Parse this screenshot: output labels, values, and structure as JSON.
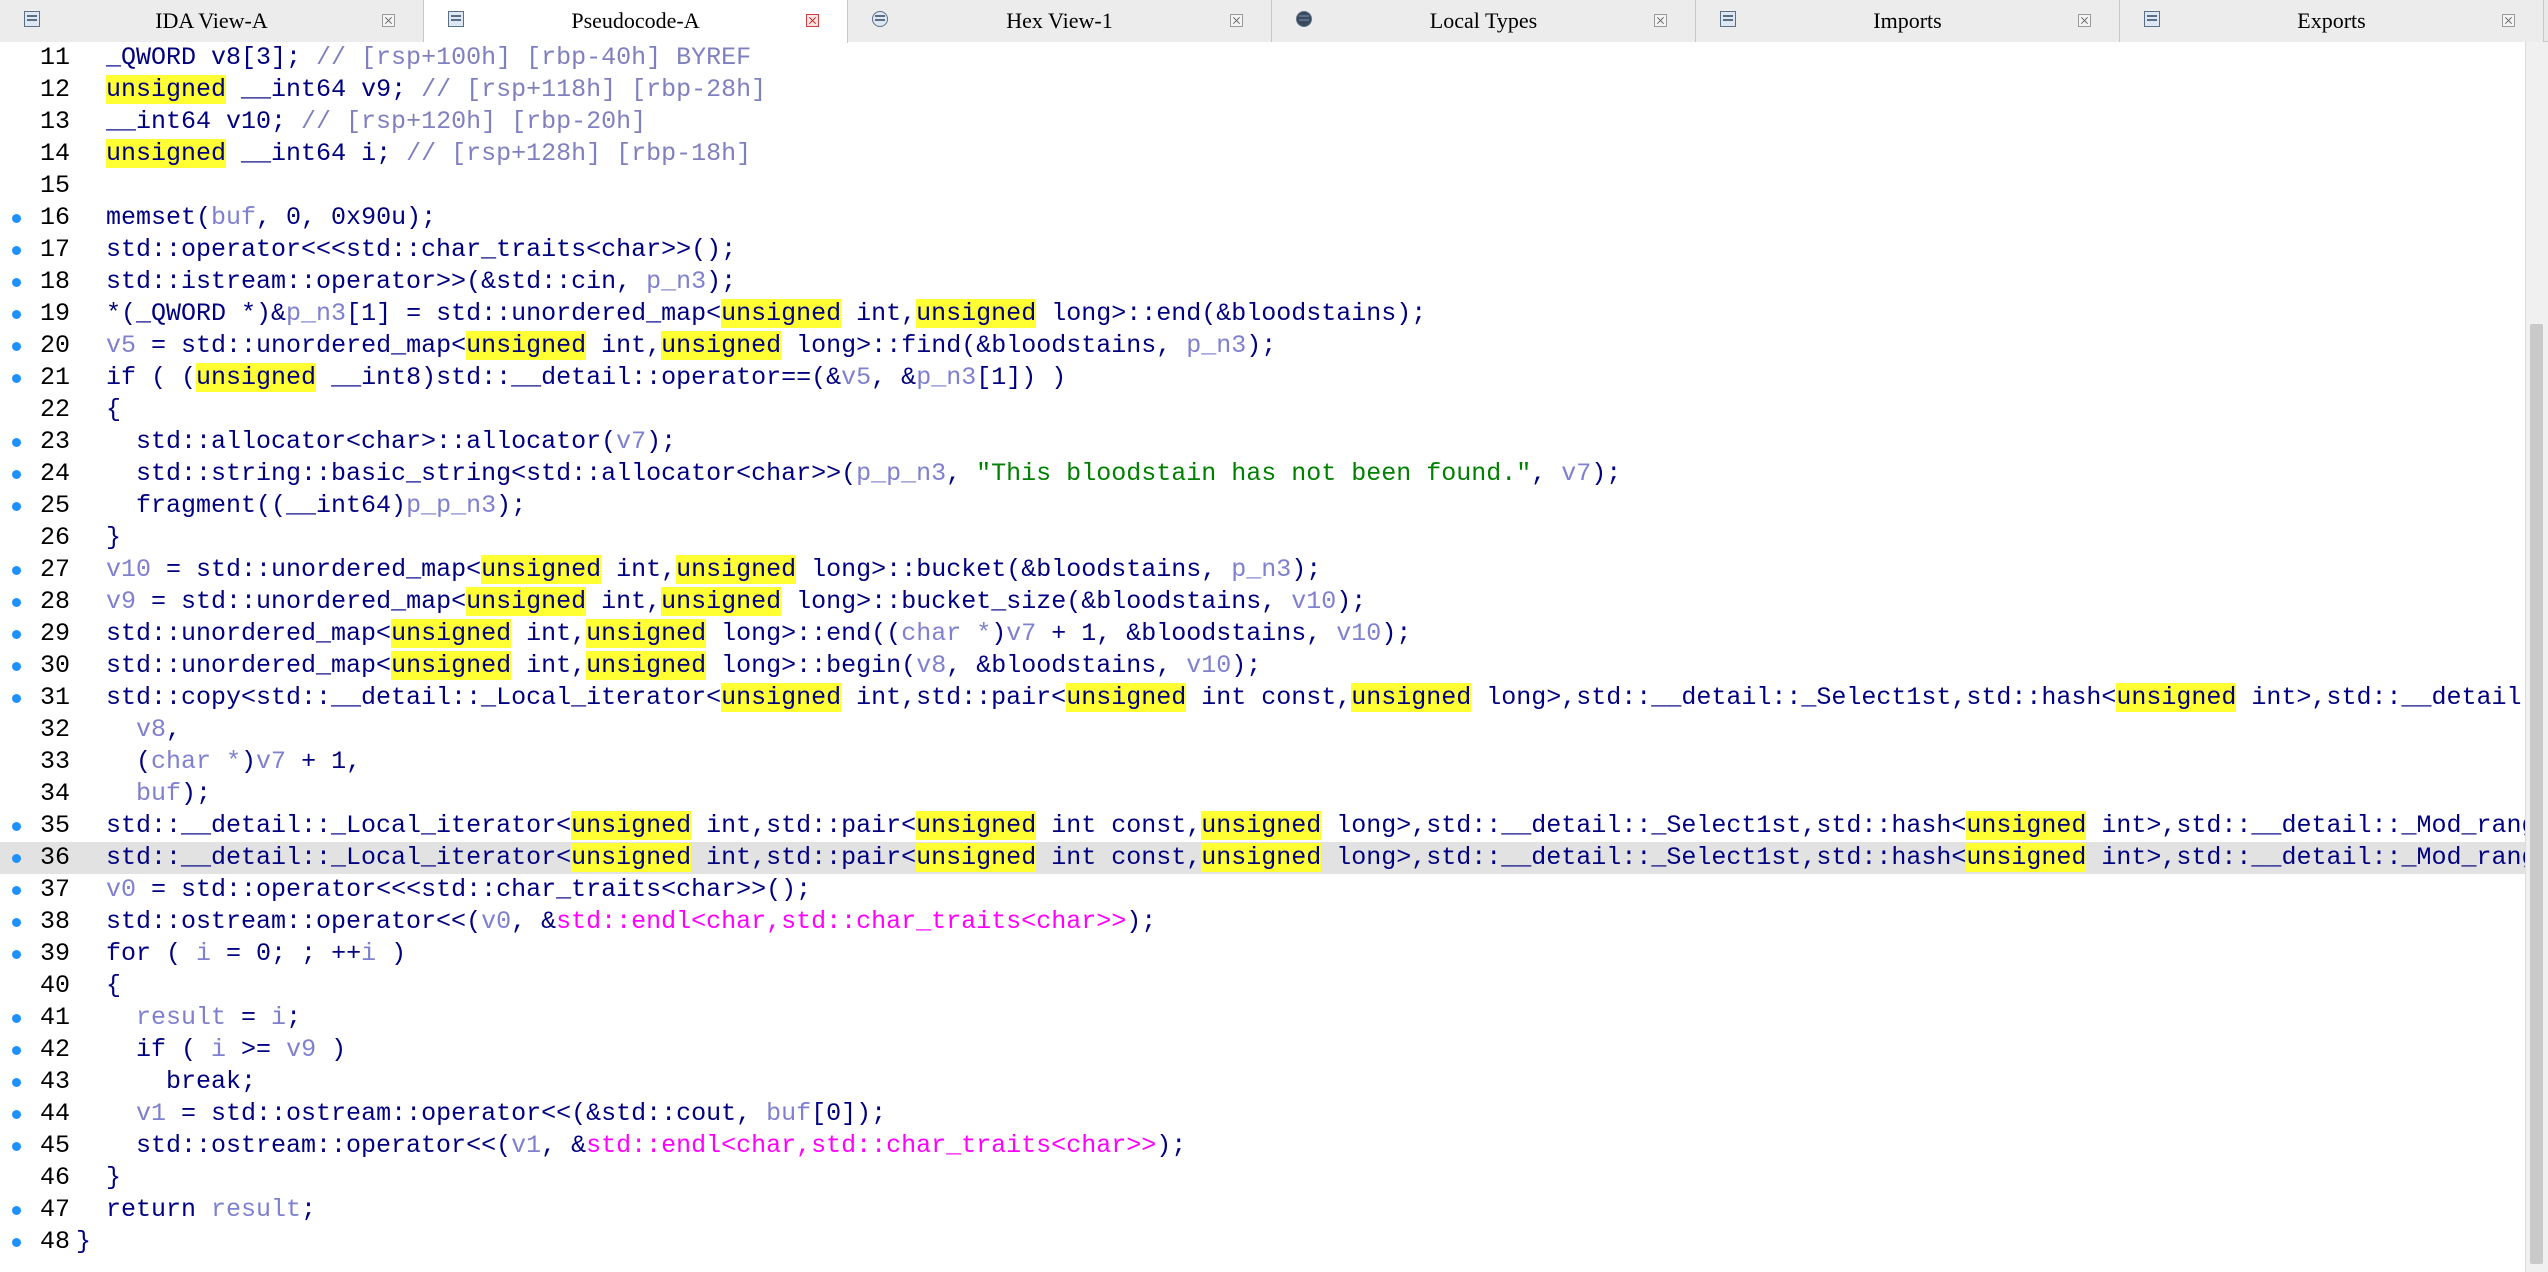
{
  "tabs": [
    {
      "label": "IDA View-A",
      "icon": "ida-view-icon",
      "active": false
    },
    {
      "label": "Pseudocode-A",
      "icon": "pseudocode-icon",
      "active": true
    },
    {
      "label": "Hex View-1",
      "icon": "hex-view-icon",
      "active": false
    },
    {
      "label": "Local Types",
      "icon": "local-types-icon",
      "active": false
    },
    {
      "label": "Imports",
      "icon": "imports-icon",
      "active": false
    },
    {
      "label": "Exports",
      "icon": "exports-icon",
      "active": false
    }
  ],
  "colors": {
    "keyword": "#000080",
    "variable": "#8080d0",
    "comment": "#8080c0",
    "string": "#008000",
    "macro": "#ff00ff",
    "highlight": "#ffff33",
    "breakpoint_dot": "#1e90ff"
  },
  "current_line": "36",
  "lines": [
    {
      "no": "11",
      "dot": false,
      "tokens": [
        [
          "p",
          "  _QWORD v8[3]; "
        ],
        [
          "c",
          "// [rsp+100h] [rbp-40h] BYREF"
        ]
      ]
    },
    {
      "no": "12",
      "dot": false,
      "tokens": [
        [
          "p",
          "  "
        ],
        [
          "h",
          "unsigned"
        ],
        [
          "p",
          " __int64 v9; "
        ],
        [
          "c",
          "// [rsp+118h] [rbp-28h]"
        ]
      ]
    },
    {
      "no": "13",
      "dot": false,
      "tokens": [
        [
          "p",
          "  __int64 v10; "
        ],
        [
          "c",
          "// [rsp+120h] [rbp-20h]"
        ]
      ]
    },
    {
      "no": "14",
      "dot": false,
      "tokens": [
        [
          "p",
          "  "
        ],
        [
          "h",
          "unsigned"
        ],
        [
          "p",
          " __int64 i; "
        ],
        [
          "c",
          "// [rsp+128h] [rbp-18h]"
        ]
      ]
    },
    {
      "no": "15",
      "dot": false,
      "tokens": [
        [
          "p",
          ""
        ]
      ]
    },
    {
      "no": "16",
      "dot": true,
      "tokens": [
        [
          "p",
          "  memset("
        ],
        [
          "v",
          "buf"
        ],
        [
          "p",
          ", 0, 0x90u);"
        ]
      ]
    },
    {
      "no": "17",
      "dot": true,
      "tokens": [
        [
          "p",
          "  std::operator<<<std::char_traits<char>>();"
        ]
      ]
    },
    {
      "no": "18",
      "dot": true,
      "tokens": [
        [
          "p",
          "  std::istream::operator>>(&std::cin, "
        ],
        [
          "v",
          "p_n3"
        ],
        [
          "p",
          ");"
        ]
      ]
    },
    {
      "no": "19",
      "dot": true,
      "tokens": [
        [
          "p",
          "  *(_QWORD *)&"
        ],
        [
          "v",
          "p_n3"
        ],
        [
          "p",
          "[1] = std::unordered_map<"
        ],
        [
          "h",
          "unsigned"
        ],
        [
          "p",
          " int,"
        ],
        [
          "h",
          "unsigned"
        ],
        [
          "p",
          " long>::end(&bloodstains);"
        ]
      ]
    },
    {
      "no": "20",
      "dot": true,
      "tokens": [
        [
          "p",
          "  "
        ],
        [
          "v",
          "v5"
        ],
        [
          "p",
          " = std::unordered_map<"
        ],
        [
          "h",
          "unsigned"
        ],
        [
          "p",
          " int,"
        ],
        [
          "h",
          "unsigned"
        ],
        [
          "p",
          " long>::find(&bloodstains, "
        ],
        [
          "v",
          "p_n3"
        ],
        [
          "p",
          ");"
        ]
      ]
    },
    {
      "no": "21",
      "dot": true,
      "tokens": [
        [
          "p",
          "  if ( ("
        ],
        [
          "h",
          "unsigned"
        ],
        [
          "p",
          " __int8)std::__detail::operator==(&"
        ],
        [
          "v",
          "v5"
        ],
        [
          "p",
          ", &"
        ],
        [
          "v",
          "p_n3"
        ],
        [
          "p",
          "[1]) )"
        ]
      ]
    },
    {
      "no": "22",
      "dot": false,
      "tokens": [
        [
          "p",
          "  {"
        ]
      ]
    },
    {
      "no": "23",
      "dot": true,
      "tokens": [
        [
          "p",
          "    std::allocator<char>::allocator("
        ],
        [
          "v",
          "v7"
        ],
        [
          "p",
          ");"
        ]
      ]
    },
    {
      "no": "24",
      "dot": true,
      "tokens": [
        [
          "p",
          "    std::string::basic_string<std::allocator<char>>("
        ],
        [
          "v",
          "p_p_n3"
        ],
        [
          "p",
          ", "
        ],
        [
          "s",
          "\"This bloodstain has not been found.\""
        ],
        [
          "p",
          ", "
        ],
        [
          "v",
          "v7"
        ],
        [
          "p",
          ");"
        ]
      ]
    },
    {
      "no": "25",
      "dot": true,
      "tokens": [
        [
          "p",
          "    fragment((__int64)"
        ],
        [
          "v",
          "p_p_n3"
        ],
        [
          "p",
          ");"
        ]
      ]
    },
    {
      "no": "26",
      "dot": false,
      "tokens": [
        [
          "p",
          "  }"
        ]
      ]
    },
    {
      "no": "27",
      "dot": true,
      "tokens": [
        [
          "p",
          "  "
        ],
        [
          "v",
          "v10"
        ],
        [
          "p",
          " = std::unordered_map<"
        ],
        [
          "h",
          "unsigned"
        ],
        [
          "p",
          " int,"
        ],
        [
          "h",
          "unsigned"
        ],
        [
          "p",
          " long>::bucket(&bloodstains, "
        ],
        [
          "v",
          "p_n3"
        ],
        [
          "p",
          ");"
        ]
      ]
    },
    {
      "no": "28",
      "dot": true,
      "tokens": [
        [
          "p",
          "  "
        ],
        [
          "v",
          "v9"
        ],
        [
          "p",
          " = std::unordered_map<"
        ],
        [
          "h",
          "unsigned"
        ],
        [
          "p",
          " int,"
        ],
        [
          "h",
          "unsigned"
        ],
        [
          "p",
          " long>::bucket_size(&bloodstains, "
        ],
        [
          "v",
          "v10"
        ],
        [
          "p",
          ");"
        ]
      ]
    },
    {
      "no": "29",
      "dot": true,
      "tokens": [
        [
          "p",
          "  std::unordered_map<"
        ],
        [
          "h",
          "unsigned"
        ],
        [
          "p",
          " int,"
        ],
        [
          "h",
          "unsigned"
        ],
        [
          "p",
          " long>::end(("
        ],
        [
          "v",
          "char *"
        ],
        [
          "p",
          ")"
        ],
        [
          "v",
          "v7"
        ],
        [
          "p",
          " + 1, &bloodstains, "
        ],
        [
          "v",
          "v10"
        ],
        [
          "p",
          ");"
        ]
      ]
    },
    {
      "no": "30",
      "dot": true,
      "tokens": [
        [
          "p",
          "  std::unordered_map<"
        ],
        [
          "h",
          "unsigned"
        ],
        [
          "p",
          " int,"
        ],
        [
          "h",
          "unsigned"
        ],
        [
          "p",
          " long>::begin("
        ],
        [
          "v",
          "v8"
        ],
        [
          "p",
          ", &bloodstains, "
        ],
        [
          "v",
          "v10"
        ],
        [
          "p",
          ");"
        ]
      ]
    },
    {
      "no": "31",
      "dot": true,
      "tokens": [
        [
          "p",
          "  std::copy<std::__detail::_Local_iterator<"
        ],
        [
          "h",
          "unsigned"
        ],
        [
          "p",
          " int,std::pair<"
        ],
        [
          "h",
          "unsigned"
        ],
        [
          "p",
          " int const,"
        ],
        [
          "h",
          "unsigned"
        ],
        [
          "p",
          " long>,std::__detail::_Select1st,std::hash<"
        ],
        [
          "h",
          "unsigned"
        ],
        [
          "p",
          " int>,std::__detail"
        ]
      ]
    },
    {
      "no": "32",
      "dot": false,
      "tokens": [
        [
          "p",
          "    "
        ],
        [
          "v",
          "v8"
        ],
        [
          "p",
          ","
        ]
      ]
    },
    {
      "no": "33",
      "dot": false,
      "tokens": [
        [
          "p",
          "    ("
        ],
        [
          "v",
          "char *"
        ],
        [
          "p",
          ")"
        ],
        [
          "v",
          "v7"
        ],
        [
          "p",
          " + 1,"
        ]
      ]
    },
    {
      "no": "34",
      "dot": false,
      "tokens": [
        [
          "p",
          "    "
        ],
        [
          "v",
          "buf"
        ],
        [
          "p",
          ");"
        ]
      ]
    },
    {
      "no": "35",
      "dot": true,
      "tokens": [
        [
          "p",
          "  std::__detail::_Local_iterator<"
        ],
        [
          "h",
          "unsigned"
        ],
        [
          "p",
          " int,std::pair<"
        ],
        [
          "h",
          "unsigned"
        ],
        [
          "p",
          " int const,"
        ],
        [
          "h",
          "unsigned"
        ],
        [
          "p",
          " long>,std::__detail::_Select1st,std::hash<"
        ],
        [
          "h",
          "unsigned"
        ],
        [
          "p",
          " int>,std::__detail::_Mod_rang"
        ]
      ]
    },
    {
      "no": "36",
      "dot": true,
      "tokens": [
        [
          "p",
          "  std::__detail::_Local_iterator<"
        ],
        [
          "h",
          "unsigned"
        ],
        [
          "p",
          " int,std::pair<"
        ],
        [
          "h",
          "unsigned"
        ],
        [
          "p",
          " int const,"
        ],
        [
          "h",
          "unsigned"
        ],
        [
          "p",
          " long>,std::__detail::_Select1st,std::hash<"
        ],
        [
          "h",
          "unsigned"
        ],
        [
          "p",
          " int>,std::__detail::_Mod_rang"
        ]
      ]
    },
    {
      "no": "37",
      "dot": true,
      "tokens": [
        [
          "p",
          "  "
        ],
        [
          "v",
          "v0"
        ],
        [
          "p",
          " = std::operator<<<std::char_traits<char>>();"
        ]
      ]
    },
    {
      "no": "38",
      "dot": true,
      "tokens": [
        [
          "p",
          "  std::ostream::operator<<("
        ],
        [
          "v",
          "v0"
        ],
        [
          "p",
          ", &"
        ],
        [
          "m",
          "std::endl<char,std::char_traits<char>>"
        ],
        [
          "p",
          ");"
        ]
      ]
    },
    {
      "no": "39",
      "dot": true,
      "tokens": [
        [
          "p",
          "  for ( "
        ],
        [
          "v",
          "i"
        ],
        [
          "p",
          " = 0; ; ++"
        ],
        [
          "v",
          "i"
        ],
        [
          "p",
          " )"
        ]
      ]
    },
    {
      "no": "40",
      "dot": false,
      "tokens": [
        [
          "p",
          "  {"
        ]
      ]
    },
    {
      "no": "41",
      "dot": true,
      "tokens": [
        [
          "p",
          "    "
        ],
        [
          "v",
          "result"
        ],
        [
          "p",
          " = "
        ],
        [
          "v",
          "i"
        ],
        [
          "p",
          ";"
        ]
      ]
    },
    {
      "no": "42",
      "dot": true,
      "tokens": [
        [
          "p",
          "    if ( "
        ],
        [
          "v",
          "i"
        ],
        [
          "p",
          " >= "
        ],
        [
          "v",
          "v9"
        ],
        [
          "p",
          " )"
        ]
      ]
    },
    {
      "no": "43",
      "dot": true,
      "tokens": [
        [
          "p",
          "      break;"
        ]
      ]
    },
    {
      "no": "44",
      "dot": true,
      "tokens": [
        [
          "p",
          "    "
        ],
        [
          "v",
          "v1"
        ],
        [
          "p",
          " = std::ostream::operator<<(&std::cout, "
        ],
        [
          "v",
          "buf"
        ],
        [
          "p",
          "[0]);"
        ]
      ]
    },
    {
      "no": "45",
      "dot": true,
      "tokens": [
        [
          "p",
          "    std::ostream::operator<<("
        ],
        [
          "v",
          "v1"
        ],
        [
          "p",
          ", &"
        ],
        [
          "m",
          "std::endl<char,std::char_traits<char>>"
        ],
        [
          "p",
          ");"
        ]
      ]
    },
    {
      "no": "46",
      "dot": false,
      "tokens": [
        [
          "p",
          "  }"
        ]
      ]
    },
    {
      "no": "47",
      "dot": true,
      "tokens": [
        [
          "p",
          "  return "
        ],
        [
          "v",
          "result"
        ],
        [
          "p",
          ";"
        ]
      ]
    },
    {
      "no": "48",
      "dot": true,
      "tokens": [
        [
          "p",
          "}"
        ]
      ]
    }
  ]
}
